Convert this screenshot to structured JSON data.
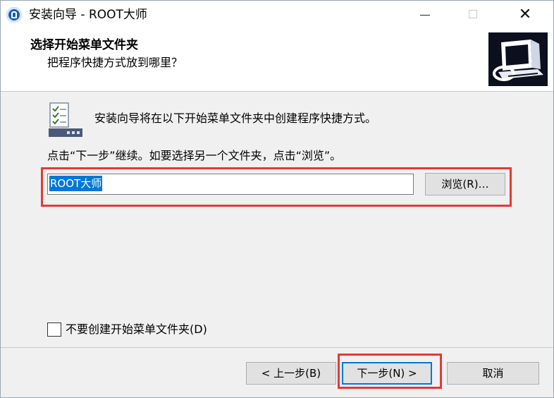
{
  "window": {
    "title": "安装向导 - ROOT大师",
    "minimize_glyph": "",
    "maximize_glyph": "",
    "close_glyph": "✕"
  },
  "header": {
    "title": "选择开始菜单文件夹",
    "subtitle": "把程序快捷方式放到哪里？"
  },
  "body": {
    "info_text": "安装向导将在以下开始菜单文件夹中创建程序快捷方式。",
    "instruction": "点击“下一步”继续。如要选择另一个文件夹，点击“浏览”。",
    "folder_value": "ROOT大师",
    "browse_label": "浏览(R)…",
    "no_folder_checkbox_label": "不要创建开始菜单文件夹(D)",
    "no_folder_checked": false
  },
  "footer": {
    "back_label": "< 上一步(B)",
    "next_label": "下一步(N) >",
    "cancel_label": "取消"
  },
  "icons": {
    "app": "app-logo-icon",
    "wizard": "computer-wizard-icon",
    "info": "checklist-panel-icon"
  },
  "colors": {
    "highlight_red": "#e53935",
    "selection_blue": "#0078d7"
  }
}
